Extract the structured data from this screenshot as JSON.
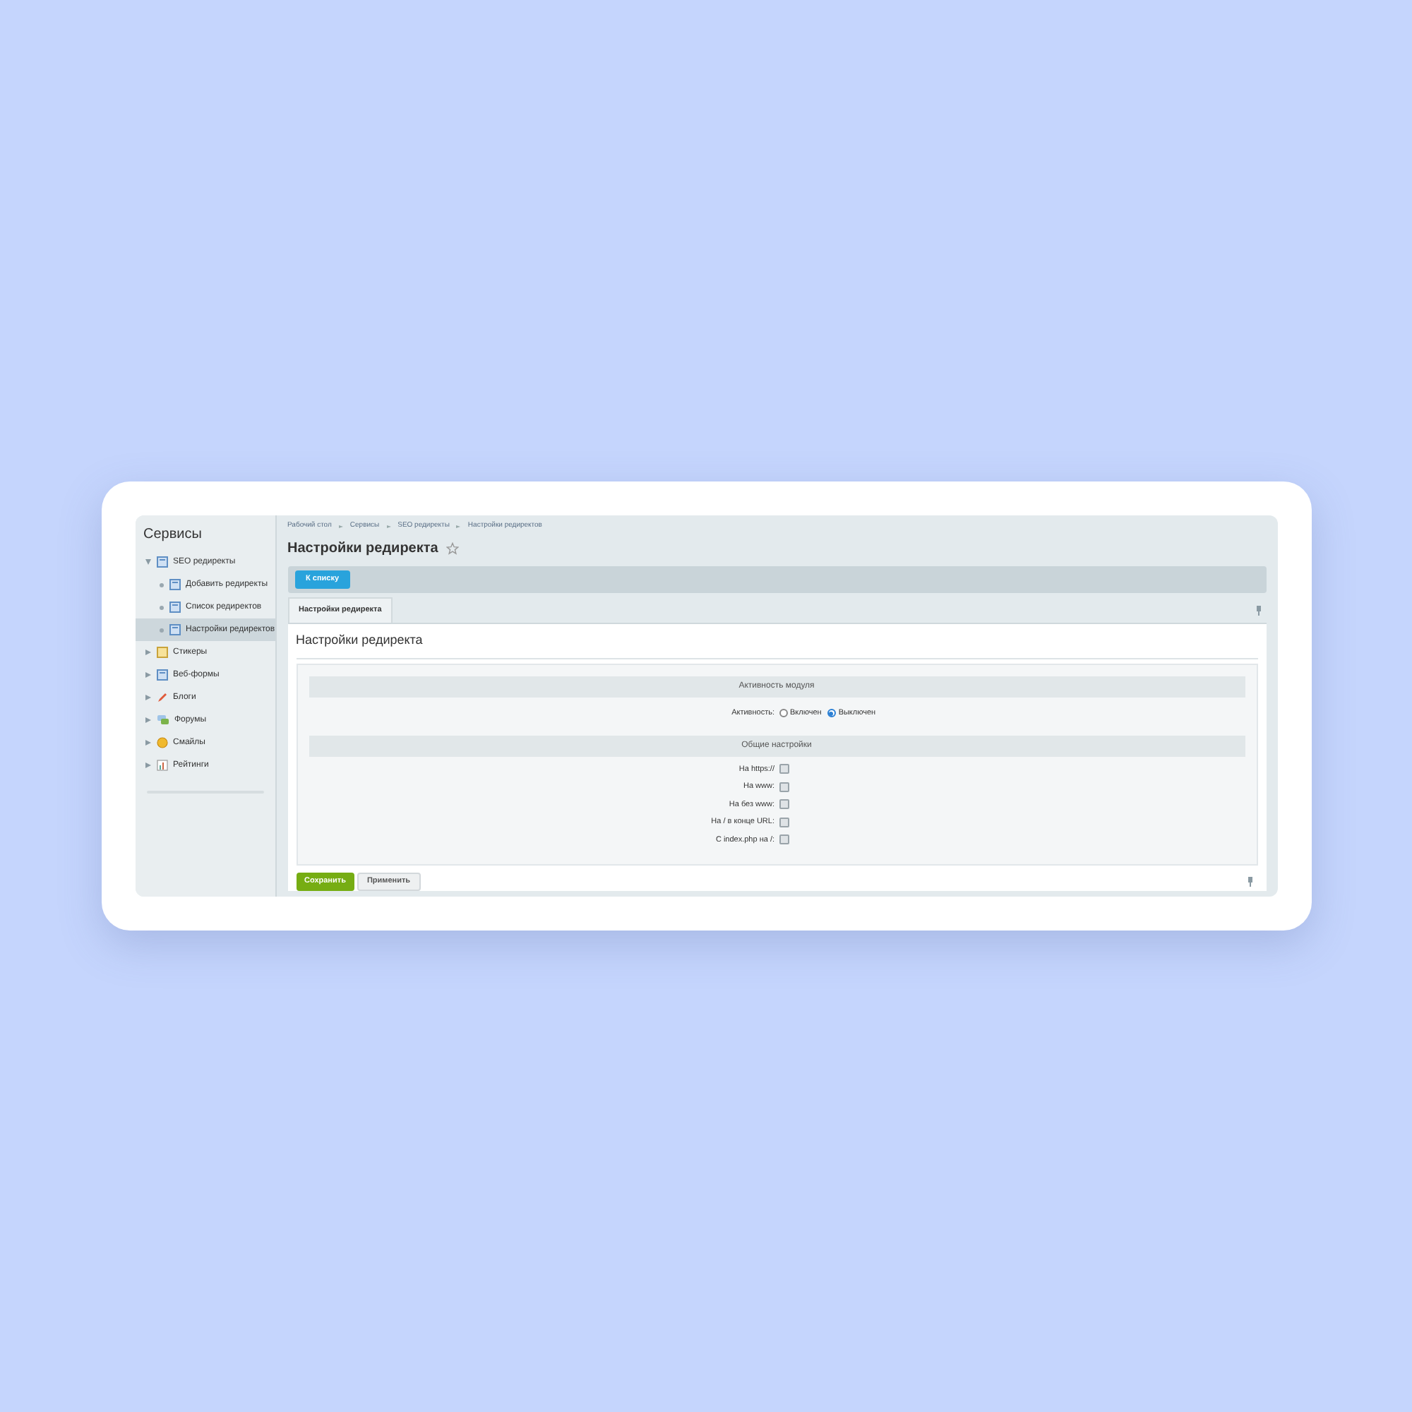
{
  "sidebar": {
    "title": "Сервисы",
    "items": [
      {
        "label": "SEO редиректы",
        "kind": "module",
        "expanded": true,
        "selected": false,
        "children": [
          {
            "label": "Добавить редиректы",
            "kind": "module",
            "selected": false
          },
          {
            "label": "Список редиректов",
            "kind": "module",
            "selected": false
          },
          {
            "label": "Настройки редиректов",
            "kind": "module",
            "selected": true
          }
        ]
      },
      {
        "label": "Стикеры",
        "kind": "sticker",
        "expanded": false,
        "selected": false
      },
      {
        "label": "Веб-формы",
        "kind": "module",
        "expanded": false,
        "selected": false
      },
      {
        "label": "Блоги",
        "kind": "blog",
        "expanded": false,
        "selected": false
      },
      {
        "label": "Форумы",
        "kind": "forum",
        "expanded": false,
        "selected": false
      },
      {
        "label": "Смайлы",
        "kind": "smile",
        "expanded": false,
        "selected": false
      },
      {
        "label": "Рейтинги",
        "kind": "rating",
        "expanded": false,
        "selected": false
      }
    ]
  },
  "breadcrumbs": [
    "Рабочий стол",
    "Сервисы",
    "SEO редиректы",
    "Настройки редиректов"
  ],
  "page_title": "Настройки редиректа",
  "back_button": "К списку",
  "tabs": [
    {
      "label": "Настройки редиректа",
      "selected": true
    }
  ],
  "form_title": "Настройки редиректа",
  "sections": [
    {
      "header": "Активность модуля",
      "rows": [
        {
          "kind": "radio",
          "label": "Активность:",
          "options": [
            {
              "label": "Включен",
              "selected": false
            },
            {
              "label": "Выключен",
              "selected": true
            }
          ]
        }
      ]
    },
    {
      "header": "Общие настройки",
      "rows": [
        {
          "kind": "checkbox",
          "label": "На https://",
          "checked": false
        },
        {
          "kind": "checkbox",
          "label": "На www:",
          "checked": false
        },
        {
          "kind": "checkbox",
          "label": "На без www:",
          "checked": false
        },
        {
          "kind": "checkbox",
          "label": "На / в конце URL:",
          "checked": false
        },
        {
          "kind": "checkbox",
          "label": "С index.php на /:",
          "checked": false
        }
      ]
    }
  ],
  "buttons": [
    {
      "label": "Сохранить",
      "kind": "primary"
    },
    {
      "label": "Применить",
      "kind": "secondary"
    }
  ]
}
